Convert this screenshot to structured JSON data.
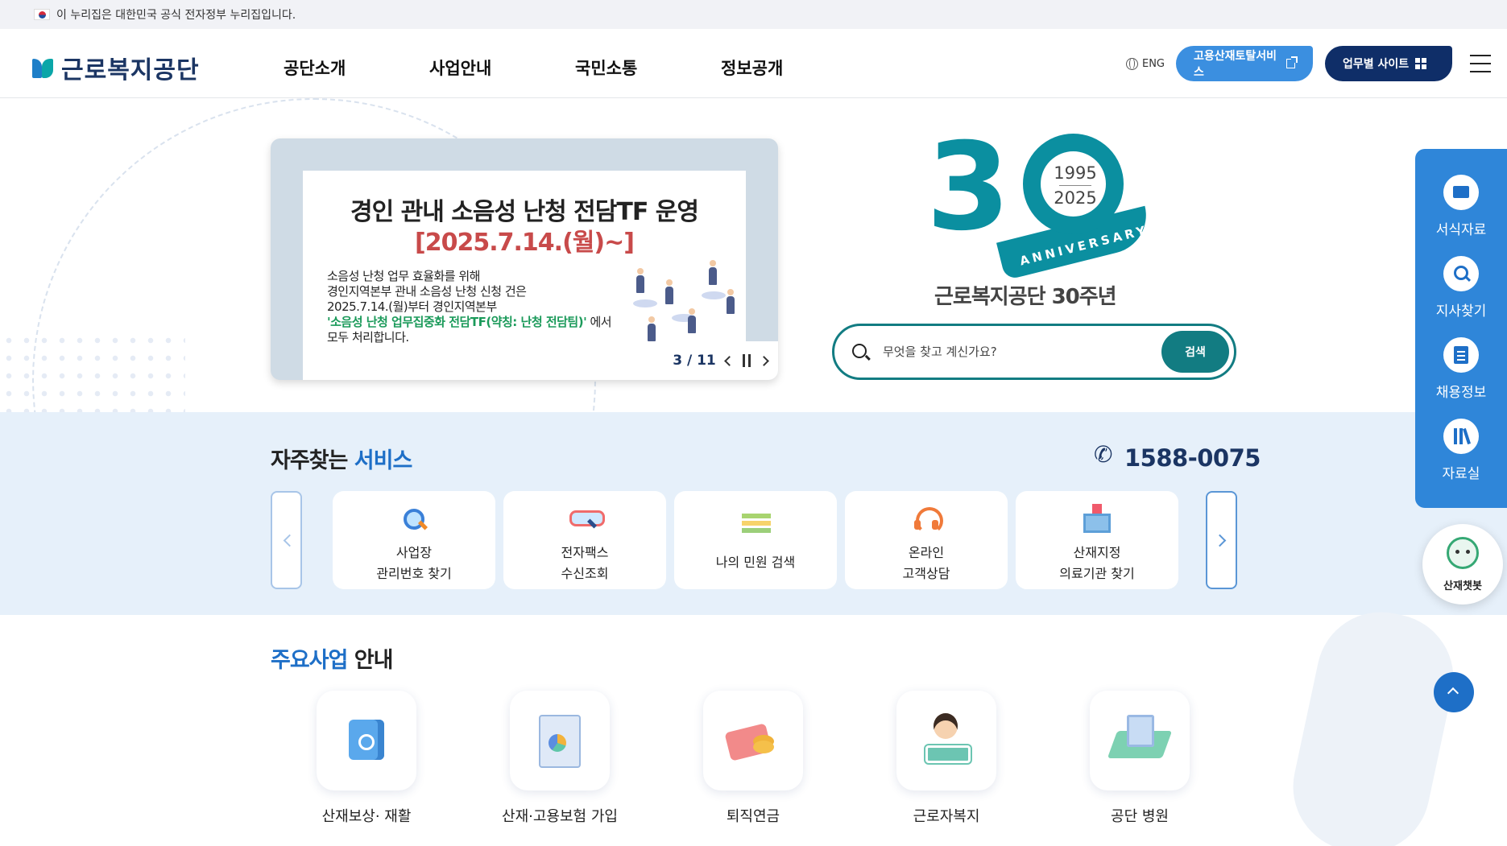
{
  "gov_banner": {
    "text": "이 누리집은 대한민국 공식 전자정부 누리집입니다."
  },
  "header": {
    "logo_text": "근로복지공단",
    "nav": [
      "공단소개",
      "사업안내",
      "국민소통",
      "정보공개"
    ],
    "lang": "ENG",
    "portal_button": "고용산재토탈서비스",
    "site_button": "업무별 사이트"
  },
  "hero": {
    "banner": {
      "title": "경인 관내 소음성 난청 전담TF 운영",
      "date": "[2025.7.14.(월)~]",
      "body_lines": [
        "소음성 난청 업무 효율화를 위해",
        "경인지역본부 관내 소음성 난청 신청 건은",
        "2025.7.14.(월)부터 경인지역본부"
      ],
      "highlight": "'소음성 난청 업무집중화 전담TF(약칭: 난청 전담팀)'",
      "highlight_suffix": " 에서",
      "last_line": "모두 처리합니다.",
      "pager": "3 / 11"
    },
    "anniversary": {
      "number": "3",
      "year_start": "1995",
      "year_end": "2025",
      "word": "ANNIVERSARY",
      "caption": "근로복지공단 30주년"
    },
    "search": {
      "placeholder": "무엇을 찾고 계신가요?",
      "button": "검색"
    }
  },
  "frequent": {
    "title_main": "자주찾는 ",
    "title_accent": "서비스",
    "phone": "1588-0075",
    "items": [
      {
        "line1": "사업장",
        "line2": "관리번호 찾기"
      },
      {
        "line1": "전자팩스",
        "line2": "수신조회"
      },
      {
        "line1": "나의 민원 검색",
        "line2": ""
      },
      {
        "line1": "온라인",
        "line2": "고객상담"
      },
      {
        "line1": "산재지정",
        "line2": "의료기관 찾기"
      }
    ]
  },
  "business": {
    "title_accent": "주요사업",
    "title_main": " 안내",
    "items": [
      "산재보상· 재활",
      "산재·고용보험 가입",
      "퇴직연금",
      "근로자복지",
      "공단 병원"
    ]
  },
  "quick_menu": {
    "items": [
      "서식자료",
      "지사찾기",
      "채용정보",
      "자료실"
    ],
    "chatbot": "산재챗봇"
  }
}
